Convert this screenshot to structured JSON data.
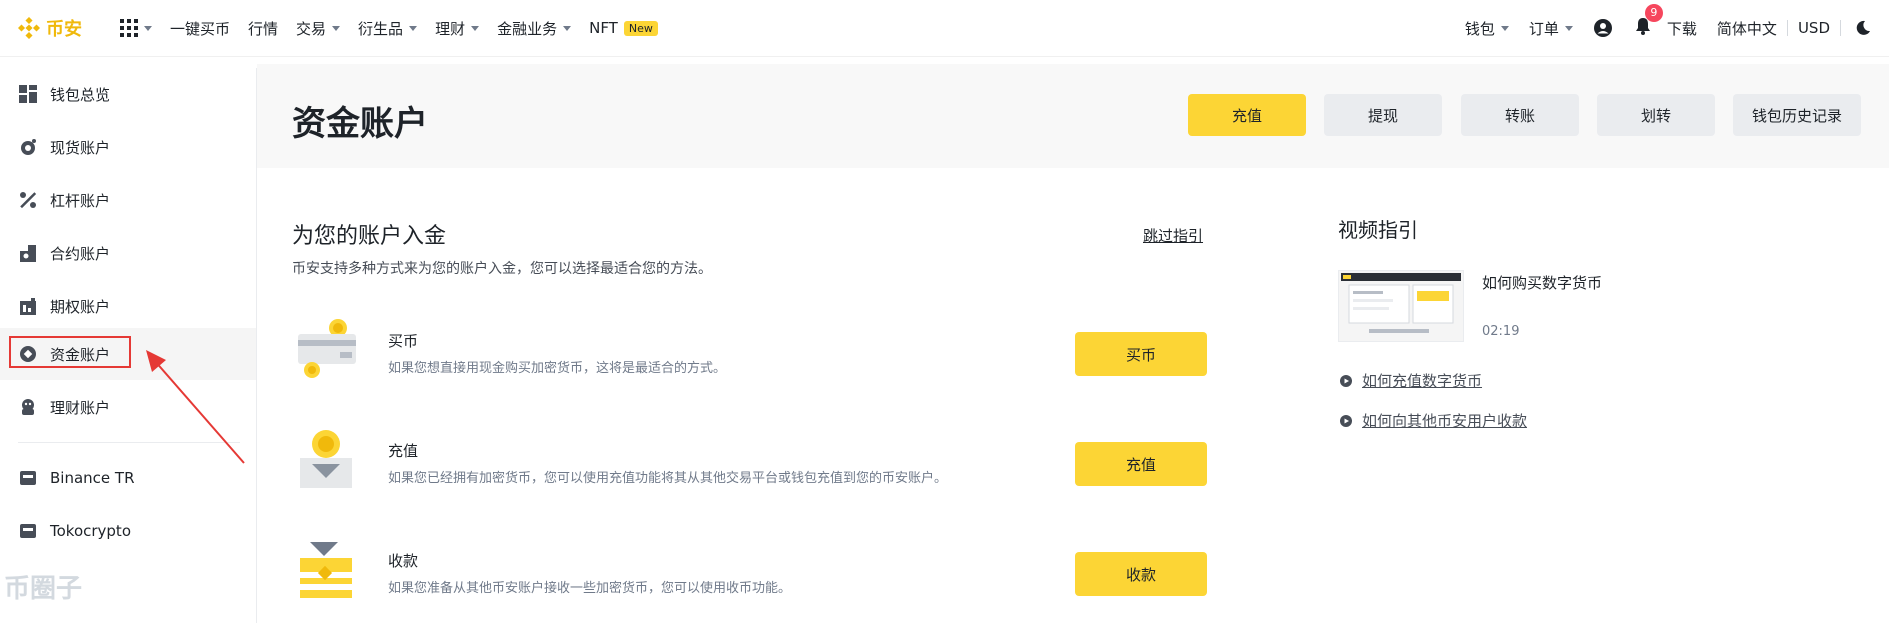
{
  "brand": {
    "name": "币安",
    "color": "#F0B90B"
  },
  "topnav": {
    "items": [
      {
        "label": "一键买币"
      },
      {
        "label": "行情"
      },
      {
        "label": "交易"
      },
      {
        "label": "衍生品"
      },
      {
        "label": "理财"
      },
      {
        "label": "金融业务"
      },
      {
        "label": "NFT",
        "badge": "New"
      }
    ],
    "right": {
      "wallet": "钱包",
      "orders": "订单",
      "notifications_count": "9",
      "download": "下载",
      "language": "简体中文",
      "currency": "USD"
    }
  },
  "sidebar": {
    "items": [
      {
        "label": "钱包总览",
        "icon": "dashboard-icon"
      },
      {
        "label": "现货账户",
        "icon": "spot-icon"
      },
      {
        "label": "杠杆账户",
        "icon": "margin-icon"
      },
      {
        "label": "合约账户",
        "icon": "futures-icon"
      },
      {
        "label": "期权账户",
        "icon": "options-icon"
      },
      {
        "label": "资金账户",
        "icon": "funding-icon",
        "active": true
      },
      {
        "label": "理财账户",
        "icon": "earn-icon"
      },
      {
        "label": "Binance TR",
        "icon": "wallet-icon"
      },
      {
        "label": "Tokocrypto",
        "icon": "wallet-icon"
      }
    ]
  },
  "header": {
    "title": "资金账户",
    "buttons": {
      "deposit": "充值",
      "withdraw": "提现",
      "transfer": "转账",
      "convert": "划转",
      "history": "钱包历史记录"
    }
  },
  "main": {
    "title": "为您的账户入金",
    "subtitle": "币安支持多种方式来为您的账户入金，您可以选择最适合您的方法。",
    "skip": "跳过指引",
    "rows": [
      {
        "title": "买币",
        "desc": "如果您想直接用现金购买加密货币，这将是最适合的方式。",
        "button": "买币"
      },
      {
        "title": "充值",
        "desc": "如果您已经拥有加密货币，您可以使用充值功能将其从其他交易平台或钱包充值到您的币安账户。",
        "button": "充值"
      },
      {
        "title": "收款",
        "desc": "如果您准备从其他币安账户接收一些加密货币，您可以使用收币功能。",
        "button": "收款"
      }
    ]
  },
  "video_guide": {
    "title": "视频指引",
    "video": {
      "name": "如何购买数字货币",
      "duration": "02:19"
    },
    "links": [
      "如何充值数字货币",
      "如何向其他币安用户收款"
    ]
  },
  "watermark": "币圈子",
  "colors": {
    "accent": "#FCD535",
    "annotation": "#E53935"
  }
}
